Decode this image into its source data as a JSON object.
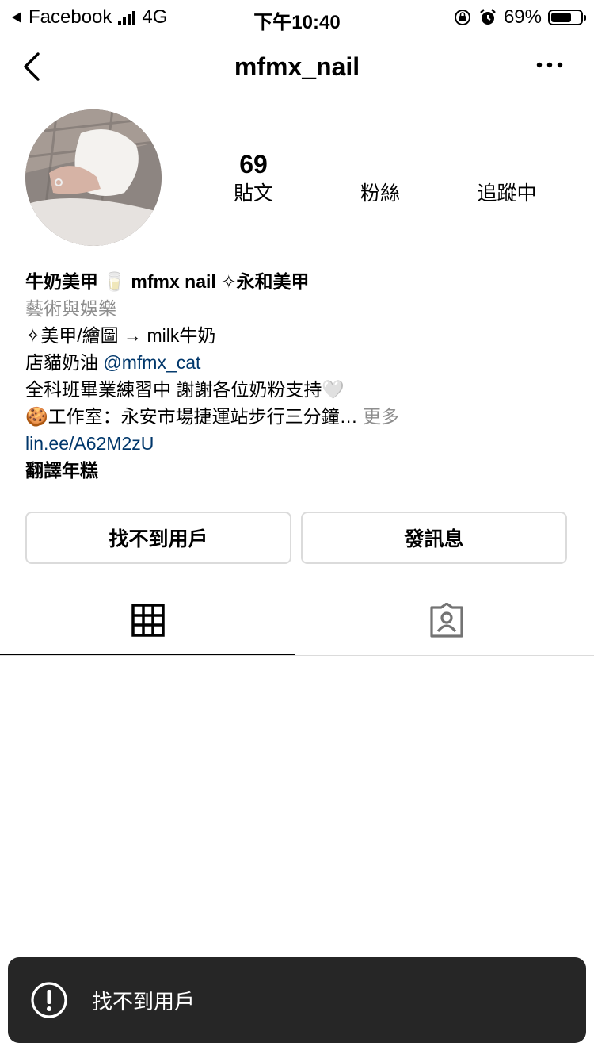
{
  "status_bar": {
    "back_app": "Facebook",
    "network": "4G",
    "time": "下午10:40",
    "battery": "69%",
    "battery_level": 0.69
  },
  "header": {
    "username": "mfmx_nail"
  },
  "stats": {
    "posts_count": "69",
    "posts_label": "貼文",
    "followers_label": "粉絲",
    "following_label": "追蹤中"
  },
  "bio": {
    "name": "牛奶美甲 🥛 mfmx nail ✧永和美甲",
    "category": "藝術與娛樂",
    "line1": "✧美甲/繪圖 → milk牛奶",
    "line2_prefix": "店貓奶油 ",
    "line2_mention": "@mfmx_cat",
    "line3": "全科班畢業練習中 謝謝各位奶粉支持🤍",
    "line4": "🍪工作室：永安市場捷運站步行三分鐘…",
    "more": "更多",
    "link": "lin.ee/A62M2zU",
    "translate": "翻譯年糕"
  },
  "buttons": {
    "primary": "找不到用戶",
    "message": "發訊息"
  },
  "toast": {
    "message": "找不到用戶"
  }
}
